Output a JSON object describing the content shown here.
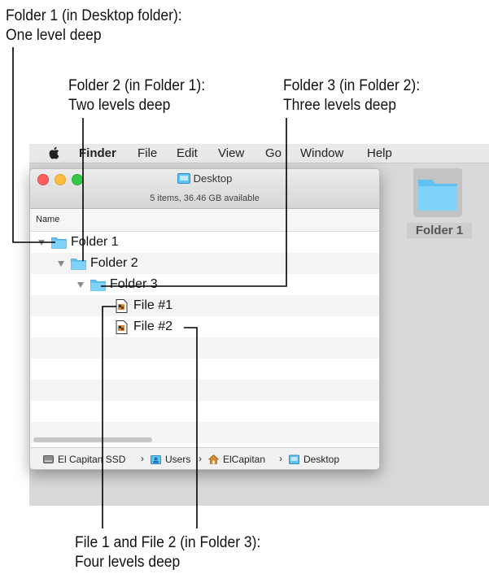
{
  "callouts": {
    "folder1": [
      "Folder 1 (in Desktop folder):",
      "One level deep"
    ],
    "folder2": [
      "Folder 2 (in Folder 1):",
      "Two levels deep"
    ],
    "folder3": [
      "Folder 3 (in Folder 2):",
      "Three levels deep"
    ],
    "files": [
      "File 1 and File 2 (in Folder 3):",
      "Four levels deep"
    ]
  },
  "menubar": {
    "app": "Finder",
    "items": [
      "File",
      "Edit",
      "View",
      "Go",
      "Window",
      "Help"
    ]
  },
  "desktop_icon": {
    "label": "Folder 1"
  },
  "window": {
    "title": "Desktop",
    "status": "5 items, 36.46 GB available",
    "column_header": "Name",
    "tree": [
      {
        "label": "Folder 1",
        "type": "folder",
        "depth": 1
      },
      {
        "label": "Folder 2",
        "type": "folder",
        "depth": 2
      },
      {
        "label": "Folder 3",
        "type": "folder",
        "depth": 3
      },
      {
        "label": "File #1",
        "type": "file",
        "depth": 4
      },
      {
        "label": "File #2",
        "type": "file",
        "depth": 4
      }
    ],
    "path": [
      "El Capitan SSD",
      "Users",
      "ElCapitan",
      "Desktop"
    ]
  },
  "colors": {
    "folder_blue": "#5fc2f2",
    "close": "#fc605c",
    "minimize": "#fdbc40",
    "zoom": "#34c84a"
  }
}
